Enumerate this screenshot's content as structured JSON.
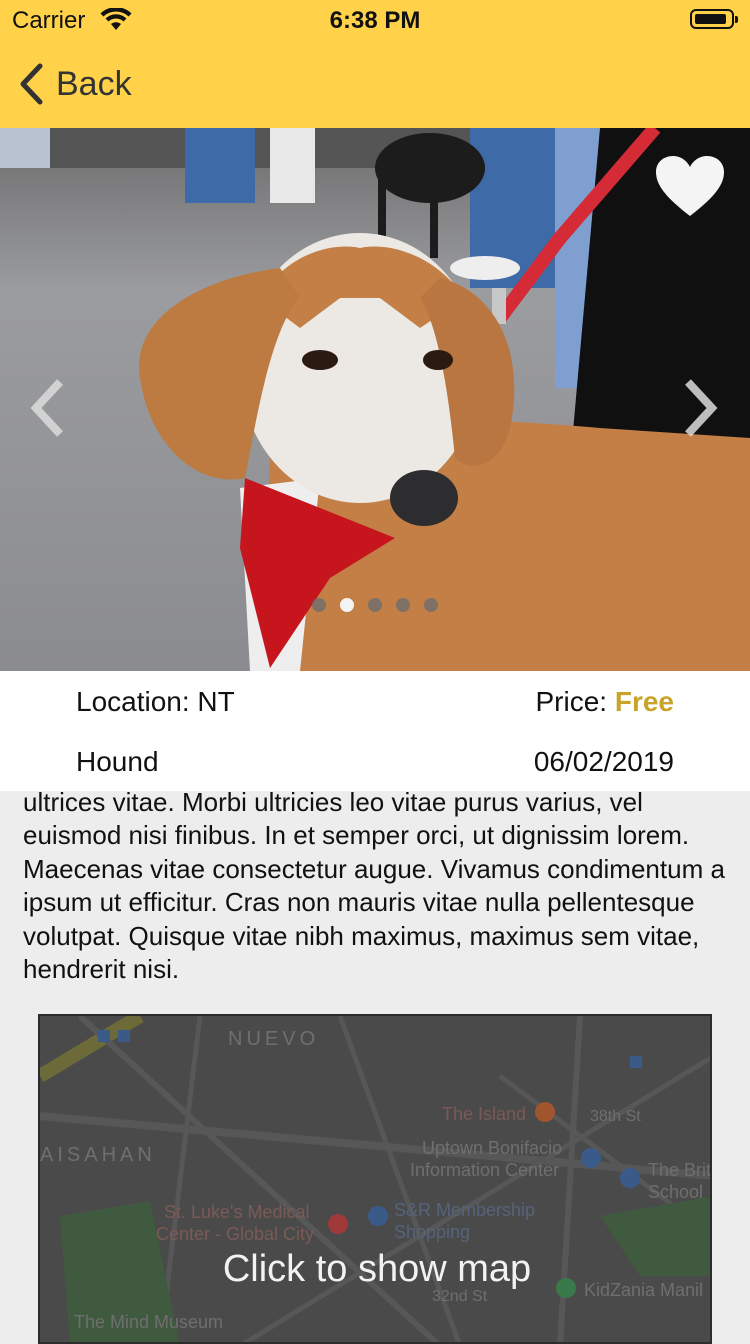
{
  "status_bar": {
    "carrier": "Carrier",
    "time": "6:38 PM"
  },
  "nav": {
    "back_label": "Back"
  },
  "colors": {
    "header_bg": "#ffd24a",
    "accent_price": "#c9a428"
  },
  "gallery": {
    "slide_count": 5,
    "active_index": 1,
    "favorited": false
  },
  "details": {
    "location_label": "Location: NT",
    "price_label": "Price:",
    "price_value": "Free",
    "breed": "Hound",
    "date": "06/02/2019"
  },
  "description": "ultrices vitae. Morbi ultricies leo vitae purus varius, vel euismod nisi finibus. In et semper orci, ut dignissim lorem. Maecenas vitae consectetur augue. Vivamus condimentum a ipsum ut efficitur. Cras non mauris vitae nulla pellentesque volutpat. Quisque vitae nibh maximus, maximus sem vitae, hendrerit nisi.",
  "map": {
    "cta": "Click to show map",
    "labels": {
      "district_top": "NUEVO",
      "district_left": "AISAHAN",
      "poi1": "The Island",
      "poi2_line1": "Uptown Bonifacio",
      "poi2_line2": "Information Center",
      "poi3_line1": "The Brit",
      "poi3_line2": "School",
      "poi4_line1": "St. Luke's Medical",
      "poi4_line2": "Center - Global City",
      "poi5_line1": "S&R Membership",
      "poi5_line2": "Shopping",
      "poi6": "KidZania Manil",
      "poi7": "The Mind Museum",
      "street1": "38th St",
      "street2": "32nd St"
    }
  }
}
